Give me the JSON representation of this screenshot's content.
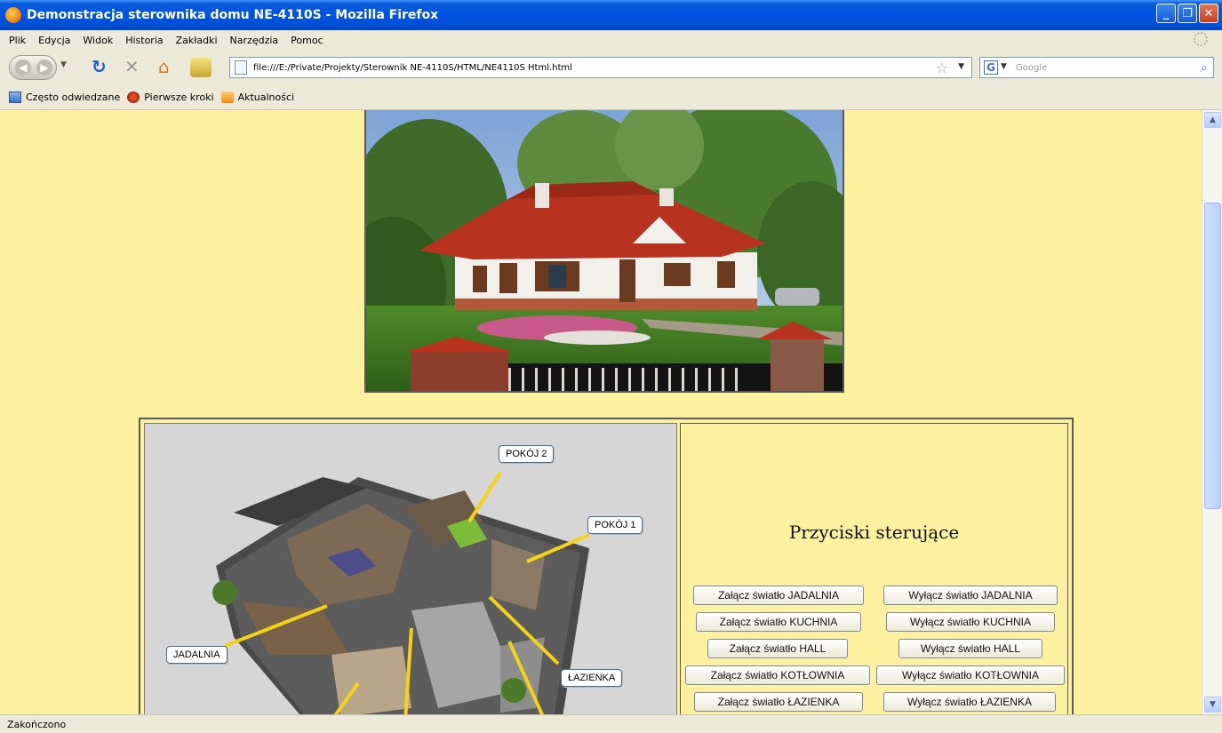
{
  "window": {
    "title": "Demonstracja sterownika domu NE-4110S - Mozilla Firefox",
    "min_symbol": "_",
    "max_symbol": "❐",
    "close_symbol": "✕"
  },
  "menu": {
    "items": [
      "Plik",
      "Edycja",
      "Widok",
      "Historia",
      "Zakładki",
      "Narzędzia",
      "Pomoc"
    ]
  },
  "toolbar": {
    "url": "file:///E:/Private/Projekty/Sterownik NE-4110S/HTML/NE4110S Html.html",
    "search_placeholder": "Google",
    "search_engine_letter": "G"
  },
  "bookmarks": {
    "items": [
      "Często odwiedzane",
      "Pierwsze kroki",
      "Aktualności"
    ]
  },
  "icons": {
    "back": "back-arrow-icon",
    "forward": "forward-arrow-icon",
    "reload": "reload-icon",
    "stop": "stop-icon",
    "home": "home-icon",
    "star": "star-icon",
    "search": "magnifier-icon"
  },
  "floorplan": {
    "labels": {
      "pokoj2": "POKÓJ 2",
      "pokoj1": "POKÓJ 1",
      "jadalnia": "JADALNIA",
      "lazienka": "ŁAZIENKA"
    }
  },
  "controls": {
    "title": "Przyciski sterujące",
    "rows": [
      {
        "on": "Załącz światło JADALNIA",
        "off": "Wyłącz światło JADALNIA"
      },
      {
        "on": "Załącz światło KUCHNIA",
        "off": "Wyłącz światło KUCHNIA"
      },
      {
        "on": "Załącz światło HALL",
        "off": "Wyłącz światło HALL"
      },
      {
        "on": "Załącz światło KOTŁOWNIA",
        "off": "Wyłącz światło KOTŁOWNIA"
      },
      {
        "on": "Załącz światło ŁAZIENKA",
        "off": "Wyłącz światło ŁAZIENKA"
      }
    ]
  },
  "status": {
    "text": "Zakończono"
  },
  "colors": {
    "page_background": "#fdf1a0",
    "titlebar_blue": "#0054e3",
    "connector_yellow": "#f5d21a"
  }
}
